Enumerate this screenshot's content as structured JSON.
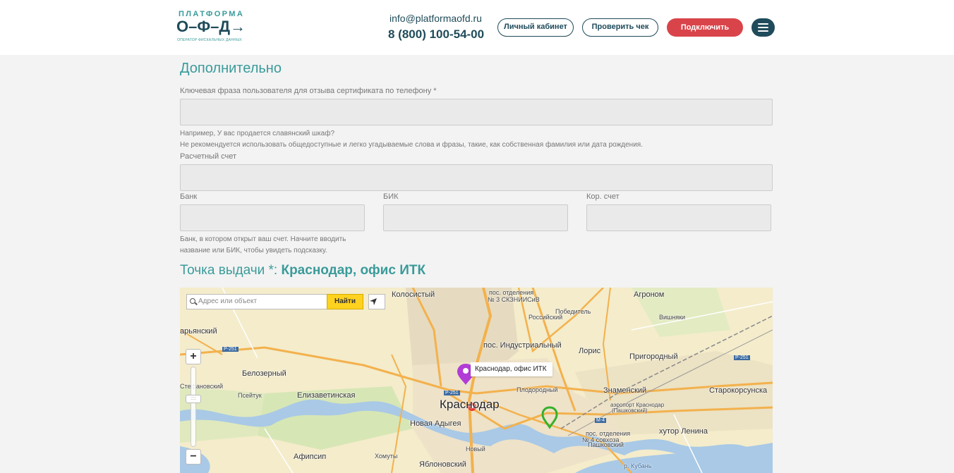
{
  "header": {
    "logo": {
      "top": "ПЛАТФОРМА",
      "mid": "О–Ф–Д→",
      "bottom": "ОПЕРАТОР ФИСКАЛЬНЫХ ДАННЫХ"
    },
    "email": "info@platformaofd.ru",
    "phone": "8 (800) 100-54-00",
    "cabinet_label": "Личный кабинет",
    "check_label": "Проверить чек",
    "connect_label": "Подключить",
    "colors": {
      "accent": "#3a9b9a",
      "dark": "#1f4b5a",
      "connect": "#d9444a"
    }
  },
  "form": {
    "section_title": "Дополнительно",
    "passphrase_label": "Ключевая фраза пользователя для отзыва сертификата по телефону *",
    "passphrase_value": "",
    "passphrase_hint_1": "Например, У вас продается славянский шкаф?",
    "passphrase_hint_2": "Не рекомендуется использовать общедоступные и легко угадываемые слова и фразы, такие, как собственная фамилия или дата рождения.",
    "account_label": "Расчетный счет",
    "account_value": "",
    "bank_label": "Банк",
    "bik_label": "БИК",
    "corr_label": "Кор. счет",
    "bank_hint_1": "Банк, в котором открыт ваш счет. Начните вводить",
    "bank_hint_2": "название или БИК, чтобы увидеть подсказку."
  },
  "point": {
    "title": "Точка выдачи *:",
    "value": "Краснодар, офис ИТК"
  },
  "map": {
    "search_placeholder": "Адрес или объект",
    "find_label": "Найти",
    "zoom_in": "+",
    "zoom_out": "−",
    "zoom_thumb": "::::",
    "balloon": "Краснодар, офис ИТК",
    "labels": {
      "kolosisty": "Колосистый",
      "pos_otd_3_a": "пос. отделения",
      "pos_otd_3_b": "№ 3 СКЗНИИСиВ",
      "agronom": "Агроном",
      "pobeditel": "Победитель",
      "rossiysky": "Российский",
      "vishnyaki": "Вишняки",
      "aryansky": "арьянский",
      "r251_a": "P-251",
      "industrialny": "пос. Индустриальный",
      "loris": "Лорис",
      "prigorodny": "Пригородный",
      "belozerny": "Белозерный",
      "stefanovsky": "Стефановский",
      "psejtuk": "Псейтук",
      "elizavetinskaya": "Елизаветинская",
      "r251_b": "P-251",
      "krasnodar": "Краснодар",
      "znamensky": "Знаменский",
      "starokorsunskaya": "Старокорсунска",
      "plodorodny": "Плодородный",
      "airport_a": "аэропорт Краснодар",
      "airport_b": "(Пашковский)",
      "r251_c": "P-251",
      "novaya_adygeya": "Новая Адыгея",
      "m4": "M-4",
      "khutor_lenina": "хутор Ленина",
      "pos_otd_4_a": "пос. отделения",
      "pos_otd_4_b": "№ 4 совхоза",
      "pashkovsky": "Пашковский",
      "novy": "Новый",
      "afipsip": "Афипсип",
      "khomuty": "Хомуты",
      "yablonovsky": "Яблоновский",
      "kuban": "р. Кубань"
    }
  }
}
